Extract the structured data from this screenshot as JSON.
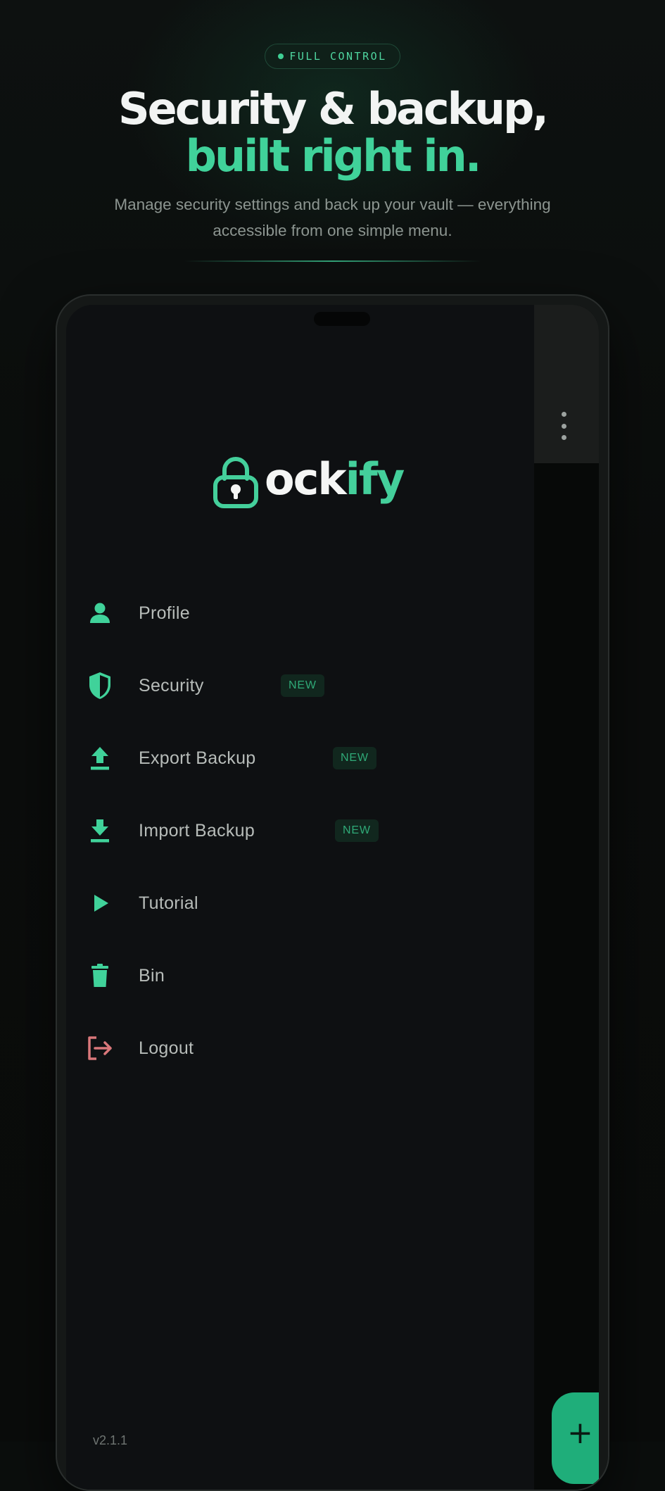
{
  "header": {
    "pill_label": "FULL CONTROL",
    "headline_line1": "Security & backup,",
    "headline_line2": "built right in.",
    "subtitle": "Manage security settings and back up your vault — everything accessible from one simple menu."
  },
  "app": {
    "logo_text_white": "ock",
    "logo_text_green": "ify",
    "menu": [
      {
        "label": "Profile",
        "icon": "person-icon",
        "badge": ""
      },
      {
        "label": "Security",
        "icon": "shield-icon",
        "badge": "NEW"
      },
      {
        "label": "Export Backup",
        "icon": "upload-icon",
        "badge": "NEW"
      },
      {
        "label": "Import Backup",
        "icon": "download-icon",
        "badge": "NEW"
      },
      {
        "label": "Tutorial",
        "icon": "play-icon",
        "badge": ""
      },
      {
        "label": "Bin",
        "icon": "trash-icon",
        "badge": ""
      },
      {
        "label": "Logout",
        "icon": "logout-icon",
        "badge": ""
      }
    ],
    "fab_label": "+",
    "version": "v2.1.1"
  },
  "colors": {
    "accent": "#40d29a",
    "accent_dark": "#1fae7a",
    "logout": "#d9777a",
    "background": "#0b0e0d",
    "drawer": "#0e1012"
  }
}
